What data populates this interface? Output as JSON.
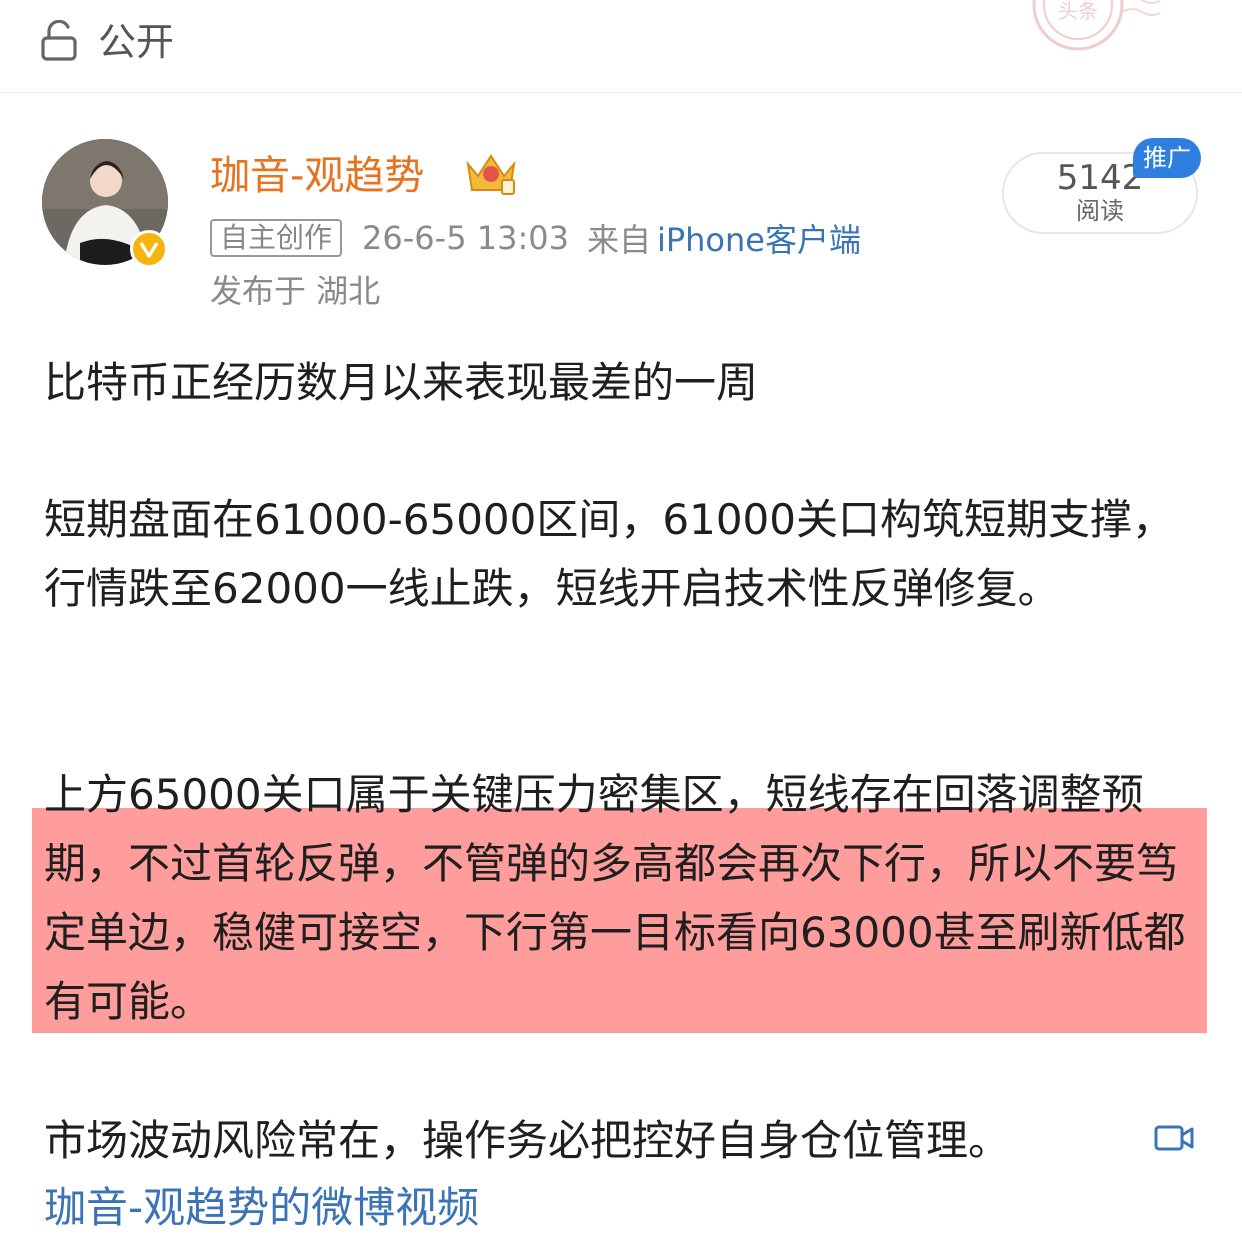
{
  "header": {
    "visibility_label": "公开",
    "lock_icon": "lock-open-icon",
    "stamp_text": "头条"
  },
  "author": {
    "avatar_icon": "avatar",
    "verified_icon": "verified-v-icon",
    "name": "珈音-观趋势",
    "crown_icon": "crown-icon",
    "origin_tag": "自主创作",
    "time": "26-6-5 13:03",
    "from_prefix": "来自",
    "client": "iPhone客户端",
    "location": "发布于 湖北"
  },
  "stats": {
    "read_count": "5142",
    "read_label": "阅读",
    "promo_badge": "推广"
  },
  "post": {
    "p1": "比特币正经历数月以来表现最差的一周",
    "p2": "短期盘面在61000-65000区间，61000关口构筑短期支撑，行情跌至62000一线止跌，短线开启技术性反弹修复。",
    "p3": "上方65000关口属于关键压力密集区，短线存在回落调整预期，不过首轮反弹，不管弹的多高都会再次下行，所以不要笃定单边，稳健可接空，下行第一目标看向63000甚至刷新低都有可能。",
    "p4": "市场波动风险常在，操作务必把控好自身仓位管理。",
    "video_icon": "video-camera-icon",
    "video_link": "珈音-观趋势的微博视频"
  },
  "colors": {
    "username": "#e8731f",
    "link": "#3a74b6",
    "highlight": "#ff9c9c",
    "badge": "#2f7fe0",
    "verified": "#f6b40c"
  }
}
